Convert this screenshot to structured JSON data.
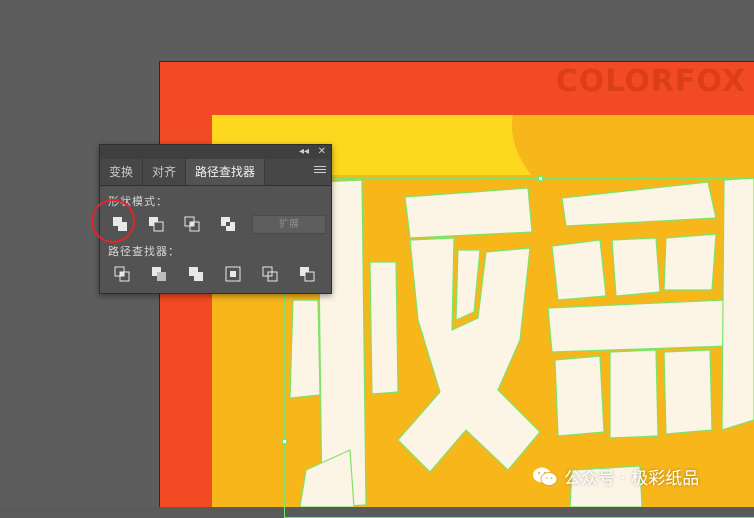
{
  "panel": {
    "collapse_glyph": "◂◂",
    "close_glyph": "✕",
    "tabs": [
      {
        "label": "变换",
        "active": false
      },
      {
        "label": "对齐",
        "active": false
      },
      {
        "label": "路径查找器",
        "active": true
      }
    ],
    "shape_modes_label": "形状模式：",
    "shape_mode_buttons": [
      "unite-icon",
      "minus-front-icon",
      "intersect-icon",
      "exclude-icon"
    ],
    "expand_label": "扩展",
    "pathfinders_label": "路径查找器：",
    "pathfinder_buttons": [
      "divide-icon",
      "trim-icon",
      "merge-icon",
      "crop-icon",
      "outline-icon",
      "minus-back-icon"
    ]
  },
  "artwork": {
    "watermark": "COLORFOX",
    "headline_chars": [
      "极",
      "彩"
    ],
    "colors": {
      "outer": "#f24a22",
      "band": "#fdd81e",
      "inner": "#f7b61a",
      "letter": "#fcf5e6",
      "selection": "#7ee36a"
    }
  },
  "footer": {
    "brand": "公众号 · 极彩纸品",
    "icon": "wechat-icon"
  },
  "annotation": {
    "highlight": "unite-button"
  }
}
